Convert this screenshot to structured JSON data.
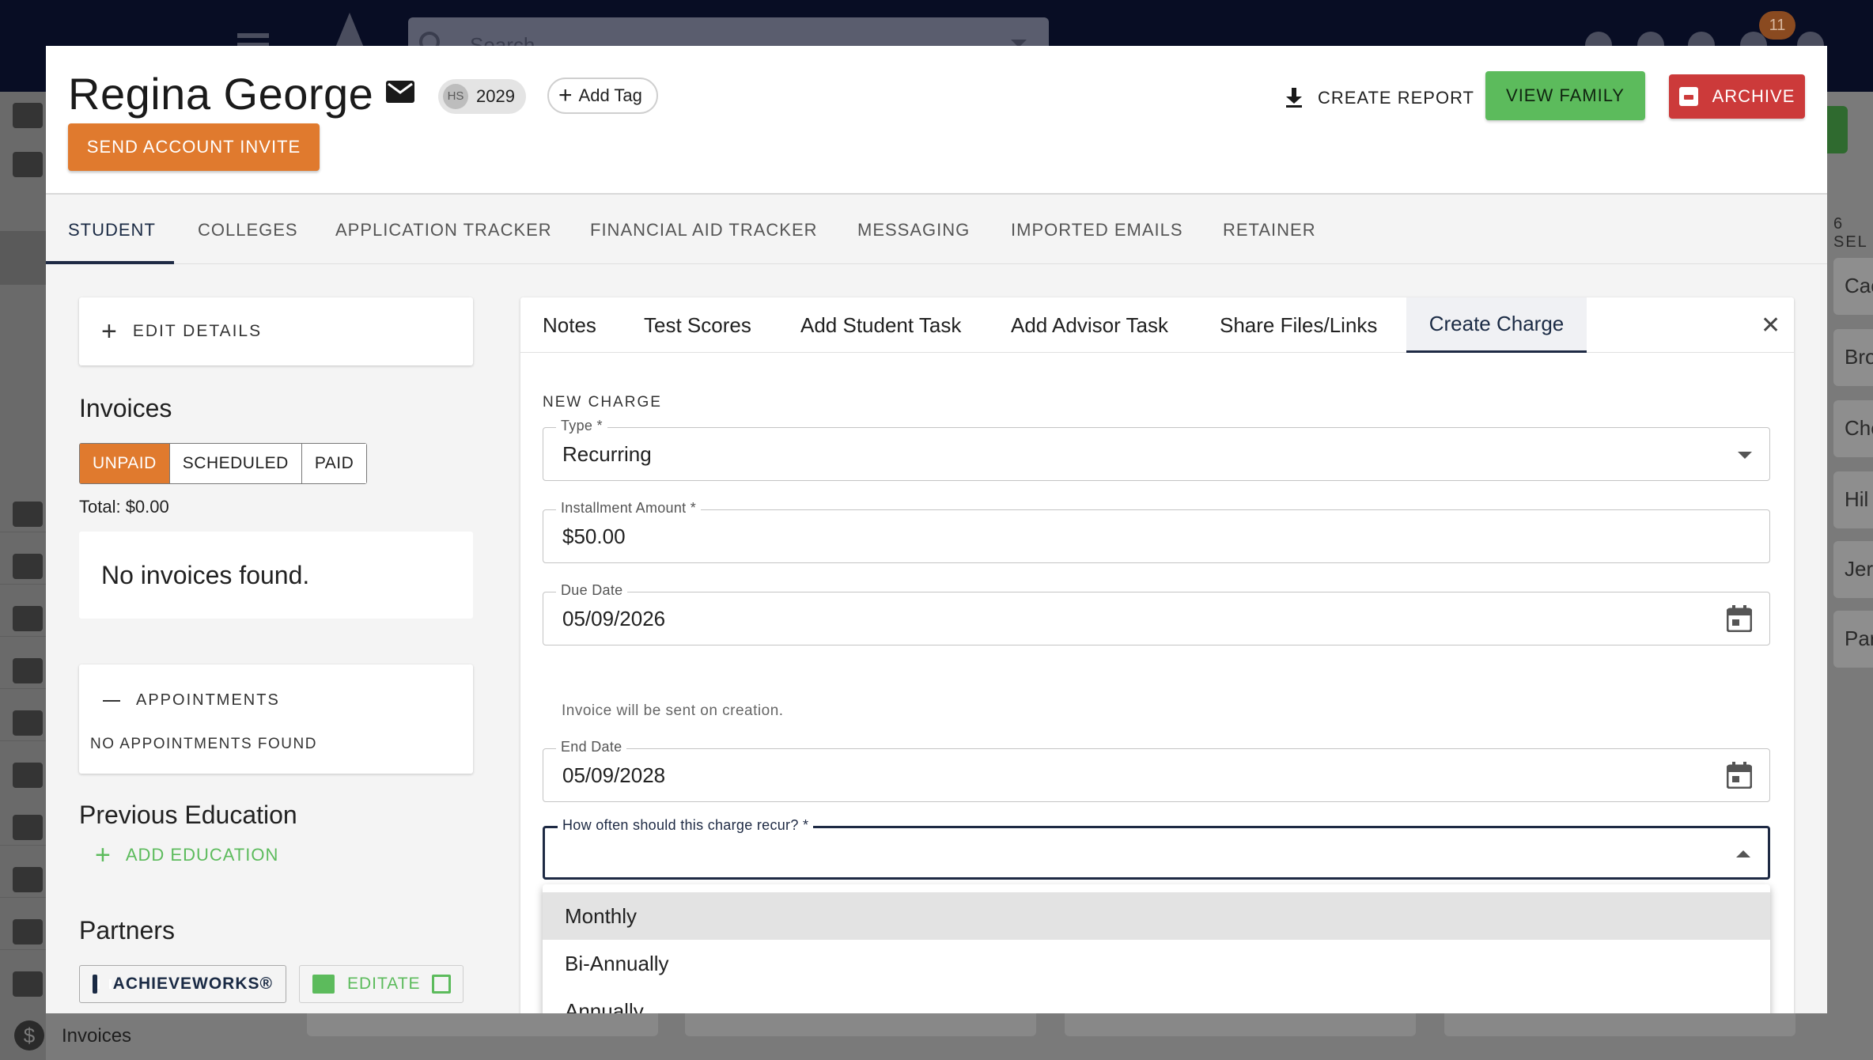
{
  "background": {
    "search_placeholder": "Search",
    "notification_count": "11",
    "sidebar_bottom_label": "Invoices",
    "right_column_header": "6 SEL",
    "right_cards": [
      "Cac",
      "Bro",
      "Che",
      "Hil",
      "Jer",
      "Par"
    ]
  },
  "header": {
    "student_name": "Regina George",
    "grade_chip_avatar": "HS",
    "grade_chip_year": "2029",
    "add_tag_label": "Add Tag",
    "send_invite_label": "SEND ACCOUNT INVITE",
    "create_report_label": "CREATE REPORT",
    "view_family_label": "VIEW FAMILY",
    "archive_label": "ARCHIVE"
  },
  "main_tabs": [
    {
      "label": "STUDENT",
      "active": true
    },
    {
      "label": "COLLEGES"
    },
    {
      "label": "APPLICATION TRACKER"
    },
    {
      "label": "FINANCIAL AID TRACKER"
    },
    {
      "label": "MESSAGING"
    },
    {
      "label": "IMPORTED EMAILS"
    },
    {
      "label": "RETAINER"
    }
  ],
  "left": {
    "edit_details_label": "EDIT DETAILS",
    "invoices_title": "Invoices",
    "invoice_filters": [
      "UNPAID",
      "SCHEDULED",
      "PAID"
    ],
    "invoice_total": "Total: $0.00",
    "no_invoices": "No invoices found.",
    "appointments_title": "APPOINTMENTS",
    "appointments_empty": "NO APPOINTMENTS FOUND",
    "previous_education_title": "Previous Education",
    "add_education_label": "ADD EDUCATION",
    "partners_title": "Partners",
    "partner_achieveworks": "ACHIEVEWORKS®",
    "partner_editate": "EDITATE"
  },
  "sub_tabs": [
    {
      "label": "Notes"
    },
    {
      "label": "Test Scores"
    },
    {
      "label": "Add Student Task"
    },
    {
      "label": "Add Advisor Task"
    },
    {
      "label": "Share Files/Links"
    },
    {
      "label": "Create Charge",
      "active": true
    }
  ],
  "charge_form": {
    "section_label": "NEW CHARGE",
    "type_label": "Type *",
    "type_value": "Recurring",
    "amount_label": "Installment Amount *",
    "amount_value": "$50.00",
    "due_date_label": "Due Date",
    "due_date_value": "05/09/2026",
    "due_date_helper": "Invoice will be sent on creation.",
    "end_date_label": "End Date",
    "end_date_value": "05/09/2028",
    "recur_label": "How often should this charge recur? *",
    "recur_value": "",
    "recur_options": [
      "Monthly",
      "Bi-Annually",
      "Annually"
    ]
  },
  "colors": {
    "orange": "#e07a2e",
    "green": "#5cbb5c",
    "red": "#cc3a3a",
    "navy": "#1e2a44"
  }
}
